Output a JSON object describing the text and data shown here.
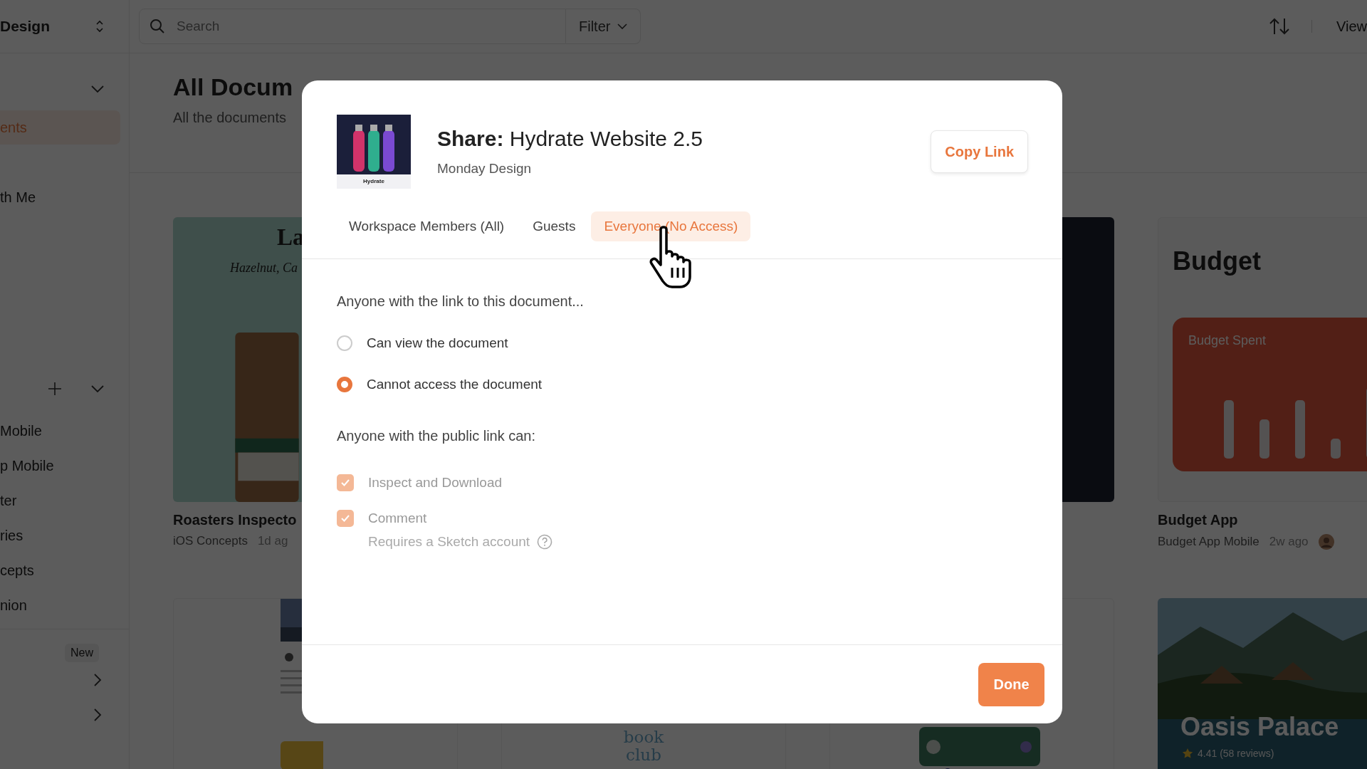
{
  "sidebar": {
    "workspace": "Design",
    "items": [
      {
        "label": "ents",
        "selected": true
      },
      {
        "label": "th Me",
        "selected": false
      }
    ],
    "projects": [
      "Mobile",
      "p Mobile",
      "ter",
      "ries",
      "cepts",
      "nion"
    ],
    "badge": "New"
  },
  "toolbar": {
    "search_placeholder": "Search",
    "filter": "Filter",
    "view": "View"
  },
  "header": {
    "title": "All Docum",
    "subtitle": "All the documents"
  },
  "documents": [
    {
      "kind": "coffee",
      "thumb_title": "La",
      "thumb_subtitle": "Hazelnut, Ca",
      "title": "Roasters Inspecto",
      "project": "iOS Concepts",
      "time": "1d ag"
    },
    {
      "kind": "hidden"
    },
    {
      "kind": "dark"
    },
    {
      "kind": "budget",
      "thumb_title": "Budget",
      "thumb_subtitle": "Budget Spent",
      "title": "Budget App",
      "project": "Budget App Mobile",
      "time": "2w ago"
    }
  ],
  "more_documents": [
    {
      "kind": "article"
    },
    {
      "kind": "logo",
      "text": "book club"
    },
    {
      "kind": "phone"
    },
    {
      "text": "Oasis Palace",
      "rating": "4.41 (58 reviews)"
    }
  ],
  "dialog": {
    "title": "**Share:** Hydrate Website 2.5",
    "workspace": "Monday Design",
    "thumbnail_label": "Hydrate",
    "copy_button": "Copy Link",
    "tabs": [
      {
        "label": "Workspace Members (All)",
        "selected": false
      },
      {
        "label": "Guests",
        "selected": false
      },
      {
        "label": "Everyone (No Access)",
        "selected": true
      }
    ],
    "link_heading": "Anyone with the link to this document...",
    "options": [
      {
        "label": "Can view the document",
        "selected": false
      },
      {
        "label": "Cannot access the document",
        "selected": true
      }
    ],
    "permissions_heading": "Anyone with the public link can:",
    "permissions": [
      {
        "label": "Inspect and Download",
        "checked": true,
        "disabled": true
      },
      {
        "label": "Comment",
        "checked": true,
        "disabled": true
      }
    ],
    "note": "Requires a Sketch account",
    "done_button": "Done"
  }
}
